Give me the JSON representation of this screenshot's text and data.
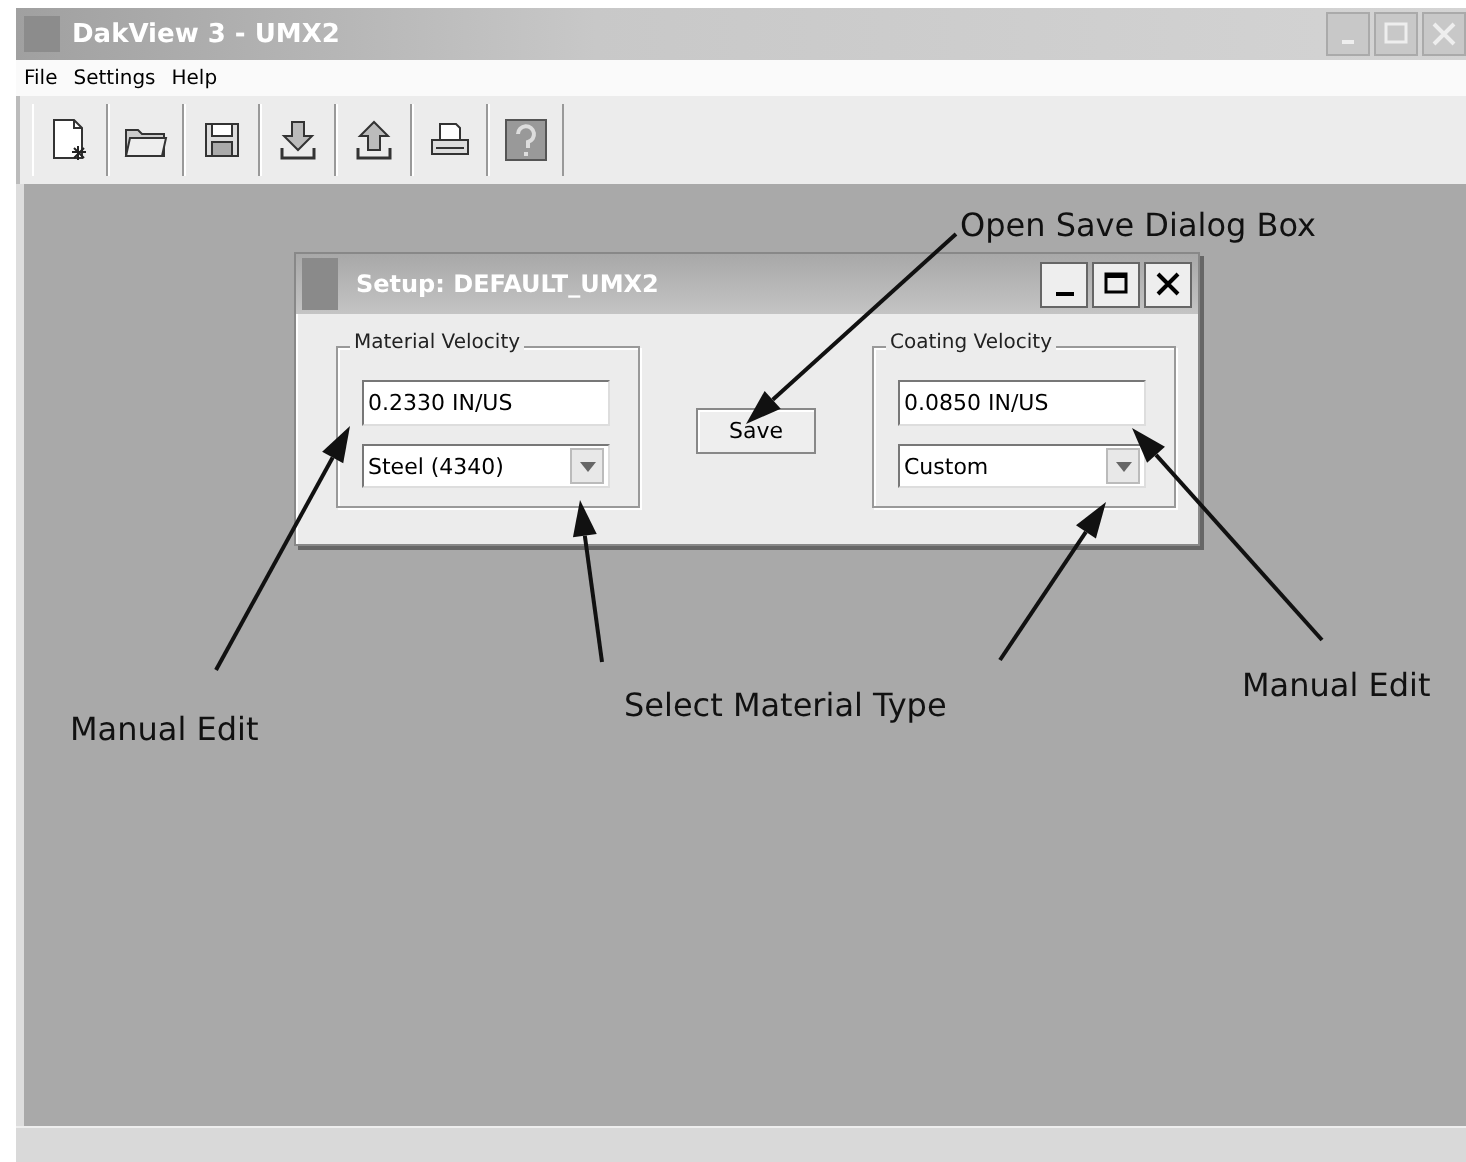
{
  "window": {
    "title": "DakView 3 - UMX2"
  },
  "menu": [
    "File",
    "Settings",
    "Help"
  ],
  "toolbar": [
    {
      "kind": "new"
    },
    {
      "kind": "open"
    },
    {
      "kind": "save"
    },
    {
      "kind": "download"
    },
    {
      "kind": "upload"
    },
    {
      "kind": "print"
    },
    {
      "kind": "help"
    }
  ],
  "dialog": {
    "title": "Setup: DEFAULT_UMX2",
    "groups": [
      {
        "label": "Material Velocity",
        "value": "0.2330 IN/US",
        "selection": "Steel (4340)"
      },
      {
        "label": "Coating Velocity",
        "value": "0.0850 IN/US",
        "selection": "Custom"
      }
    ],
    "button": "Save"
  },
  "annotations": [
    {
      "text": "Open Save Dialog Box"
    },
    {
      "text": "Manual Edit"
    },
    {
      "text": "Select Material Type"
    },
    {
      "text": "Manual Edit"
    }
  ]
}
